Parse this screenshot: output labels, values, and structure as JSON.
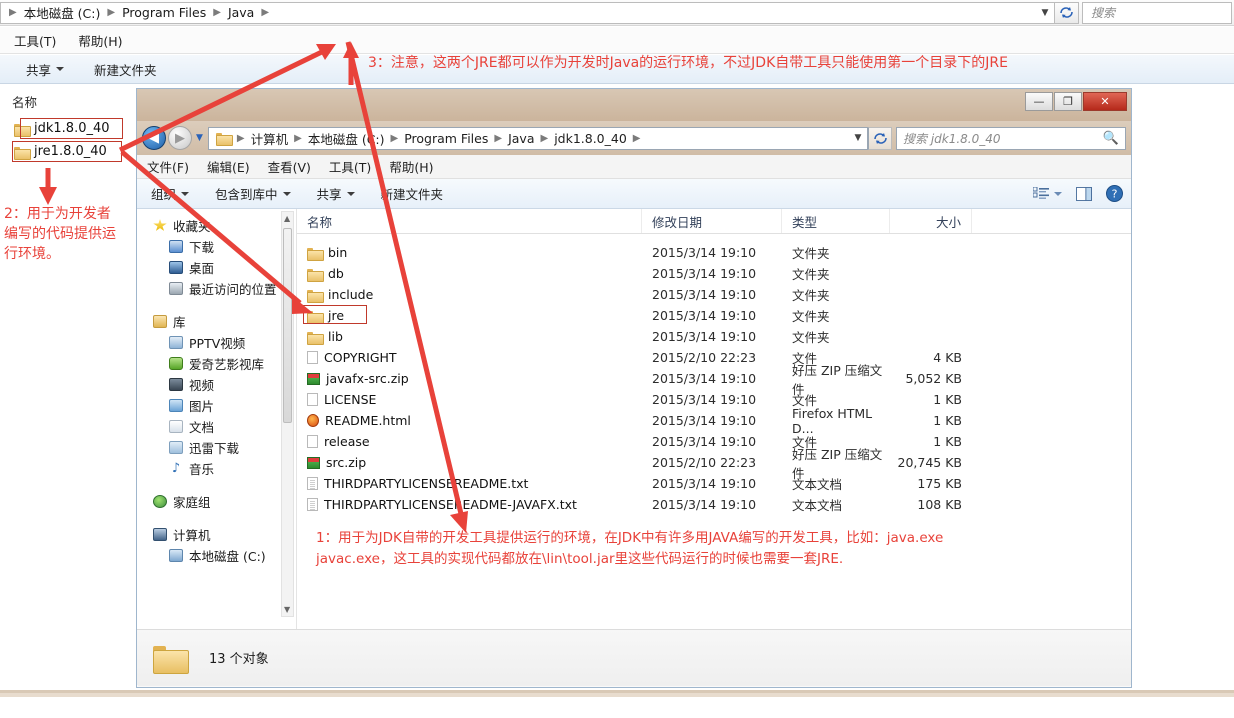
{
  "outer_window": {
    "breadcrumb": [
      "本地磁盘 (C:)",
      "Program Files",
      "Java"
    ],
    "search_placeholder": "搜索",
    "menu": [
      "工具(T)",
      "帮助(H)"
    ],
    "toolbar": [
      "共享",
      "新建文件夹"
    ],
    "column_header": "名称",
    "items": [
      {
        "name": "jdk1.8.0_40",
        "icon": "folder-icon"
      },
      {
        "name": "jre1.8.0_40",
        "icon": "folder-icon"
      }
    ]
  },
  "inner_window": {
    "title_buttons": {
      "minimize": "—",
      "maximize": "❐",
      "close": "✕"
    },
    "breadcrumb": [
      "计算机",
      "本地磁盘 (C:)",
      "Program Files",
      "Java",
      "jdk1.8.0_40"
    ],
    "search_placeholder": "搜索 jdk1.8.0_40",
    "menu": [
      "文件(F)",
      "编辑(E)",
      "查看(V)",
      "工具(T)",
      "帮助(H)"
    ],
    "toolbar": [
      "组织",
      "包含到库中",
      "共享",
      "新建文件夹"
    ],
    "nav_pane": {
      "groups": [
        {
          "label": "收藏夹",
          "icon": "star-icon",
          "color": "#f0c419",
          "children": [
            {
              "label": "下载",
              "icon": "download-icon",
              "color": "#5b8fd0"
            },
            {
              "label": "桌面",
              "icon": "desktop-icon",
              "color": "#3d6fa8"
            },
            {
              "label": "最近访问的位置",
              "icon": "recent-icon",
              "color": "#9aa6b0"
            }
          ]
        },
        {
          "label": "库",
          "icon": "library-icon",
          "color": "#e8c46a",
          "children": [
            {
              "label": "PPTV视频",
              "icon": "pptv-icon",
              "color": "#8fb4d6"
            },
            {
              "label": "爱奇艺影视库",
              "icon": "iqiyi-icon",
              "color": "#7ac143"
            },
            {
              "label": "视频",
              "icon": "video-icon",
              "color": "#4a5a6a"
            },
            {
              "label": "图片",
              "icon": "pictures-icon",
              "color": "#6ba3d6"
            },
            {
              "label": "文档",
              "icon": "documents-icon",
              "color": "#c9d4df"
            },
            {
              "label": "迅雷下载",
              "icon": "thunder-icon",
              "color": "#9fc0dd"
            },
            {
              "label": "音乐",
              "icon": "music-icon",
              "color": "#2f6fb5"
            }
          ]
        },
        {
          "label": "家庭组",
          "icon": "homegroup-icon",
          "color": "#4f9f4f",
          "children": []
        },
        {
          "label": "计算机",
          "icon": "computer-icon",
          "color": "#5a7fa8",
          "children": [
            {
              "label": "本地磁盘 (C:)",
              "icon": "drive-icon",
              "color": "#7fa8d0"
            }
          ]
        }
      ]
    },
    "columns": [
      "名称",
      "修改日期",
      "类型",
      "大小"
    ],
    "files": [
      {
        "name": "bin",
        "icon": "folder-icon",
        "date": "2015/3/14 19:10",
        "type": "文件夹",
        "size": ""
      },
      {
        "name": "db",
        "icon": "folder-icon",
        "date": "2015/3/14 19:10",
        "type": "文件夹",
        "size": ""
      },
      {
        "name": "include",
        "icon": "folder-icon",
        "date": "2015/3/14 19:10",
        "type": "文件夹",
        "size": ""
      },
      {
        "name": "jre",
        "icon": "folder-icon",
        "date": "2015/3/14 19:10",
        "type": "文件夹",
        "size": ""
      },
      {
        "name": "lib",
        "icon": "folder-icon",
        "date": "2015/3/14 19:10",
        "type": "文件夹",
        "size": ""
      },
      {
        "name": "COPYRIGHT",
        "icon": "file-icon",
        "date": "2015/2/10 22:23",
        "type": "文件",
        "size": "4 KB"
      },
      {
        "name": "javafx-src.zip",
        "icon": "zip-icon",
        "date": "2015/3/14 19:10",
        "type": "好压 ZIP 压缩文件",
        "size": "5,052 KB"
      },
      {
        "name": "LICENSE",
        "icon": "file-icon",
        "date": "2015/3/14 19:10",
        "type": "文件",
        "size": "1 KB"
      },
      {
        "name": "README.html",
        "icon": "firefox-icon",
        "date": "2015/3/14 19:10",
        "type": "Firefox HTML D...",
        "size": "1 KB"
      },
      {
        "name": "release",
        "icon": "file-icon",
        "date": "2015/3/14 19:10",
        "type": "文件",
        "size": "1 KB"
      },
      {
        "name": "src.zip",
        "icon": "zip-icon",
        "date": "2015/2/10 22:23",
        "type": "好压 ZIP 压缩文件",
        "size": "20,745 KB"
      },
      {
        "name": "THIRDPARTYLICENSEREADME.txt",
        "icon": "text-icon",
        "date": "2015/3/14 19:10",
        "type": "文本文档",
        "size": "175 KB"
      },
      {
        "name": "THIRDPARTYLICENSEREADME-JAVAFX.txt",
        "icon": "text-icon",
        "date": "2015/3/14 19:10",
        "type": "文本文档",
        "size": "108 KB"
      }
    ],
    "status": "13 个对象"
  },
  "annotations": {
    "note1": "1：用于为JDK自带的开发工具提供运行的环境，在JDK中有许多用JAVA编写的开发工具，比如：java.exe\njavac.exe，这工具的实现代码都放在\\lin\\tool.jar里这些代码运行的时候也需要一套JRE.",
    "note2": "2：用于为开发者\n编写的代码提供运\n行环境。",
    "note3": "3：注意，这两个JRE都可以作为开发时Java的运行环境，不过JDK自带工具只能使用第一个目录下的JRE"
  },
  "colors": {
    "annotation_red": "#e8423a",
    "highlight_box": "#c0392b",
    "close_button": "#b5291a"
  }
}
